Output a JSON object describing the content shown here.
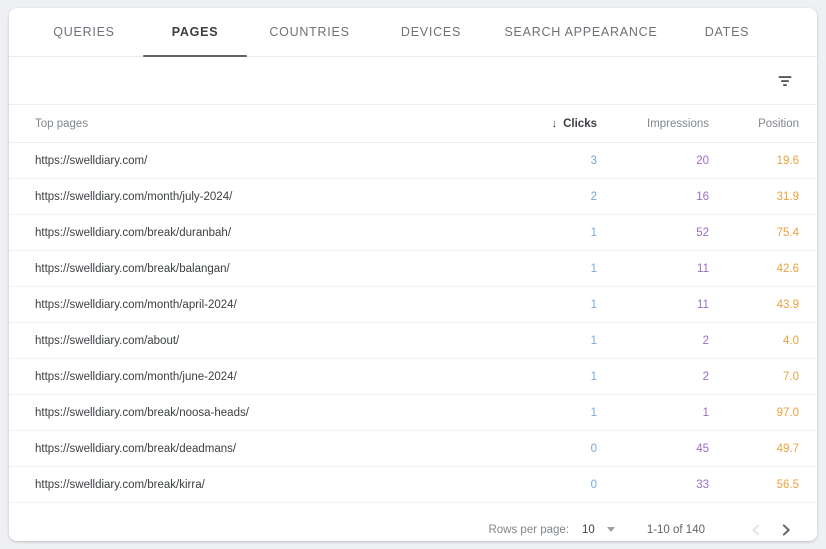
{
  "tabs": [
    {
      "label": "QUERIES",
      "active": false
    },
    {
      "label": "PAGES",
      "active": true
    },
    {
      "label": "COUNTRIES",
      "active": false
    },
    {
      "label": "DEVICES",
      "active": false
    },
    {
      "label": "SEARCH APPEARANCE",
      "active": false
    },
    {
      "label": "DATES",
      "active": false
    }
  ],
  "toolbar": {
    "filter_icon": "filter-list-icon"
  },
  "table": {
    "columns": {
      "page": "Top pages",
      "clicks": "Clicks",
      "impressions": "Impressions",
      "position": "Position"
    },
    "sort": {
      "column": "clicks",
      "direction": "descending",
      "arrow_glyph": "↓"
    },
    "rows": [
      {
        "page": "https://swelldiary.com/",
        "clicks": "3",
        "impressions": "20",
        "position": "19.6"
      },
      {
        "page": "https://swelldiary.com/month/july-2024/",
        "clicks": "2",
        "impressions": "16",
        "position": "31.9"
      },
      {
        "page": "https://swelldiary.com/break/duranbah/",
        "clicks": "1",
        "impressions": "52",
        "position": "75.4"
      },
      {
        "page": "https://swelldiary.com/break/balangan/",
        "clicks": "1",
        "impressions": "11",
        "position": "42.6"
      },
      {
        "page": "https://swelldiary.com/month/april-2024/",
        "clicks": "1",
        "impressions": "11",
        "position": "43.9"
      },
      {
        "page": "https://swelldiary.com/about/",
        "clicks": "1",
        "impressions": "2",
        "position": "4.0"
      },
      {
        "page": "https://swelldiary.com/month/june-2024/",
        "clicks": "1",
        "impressions": "2",
        "position": "7.0"
      },
      {
        "page": "https://swelldiary.com/break/noosa-heads/",
        "clicks": "1",
        "impressions": "1",
        "position": "97.0"
      },
      {
        "page": "https://swelldiary.com/break/deadmans/",
        "clicks": "0",
        "impressions": "45",
        "position": "49.7"
      },
      {
        "page": "https://swelldiary.com/break/kirra/",
        "clicks": "0",
        "impressions": "33",
        "position": "56.5"
      }
    ]
  },
  "footer": {
    "rows_per_page_label": "Rows per page:",
    "rows_per_page_value": "10",
    "range_label": "1-10 of 140",
    "prev_icon": "chevron-left-icon",
    "next_icon": "chevron-right-icon",
    "prev_enabled": false,
    "next_enabled": true
  },
  "colors": {
    "background": "#eef0f4",
    "card": "#ffffff",
    "clicks": "#7ba7d4",
    "impressions": "#9a6ec4",
    "position": "#e8a33d",
    "tab_active": "#3c4043",
    "tab_inactive": "#6d7278"
  }
}
